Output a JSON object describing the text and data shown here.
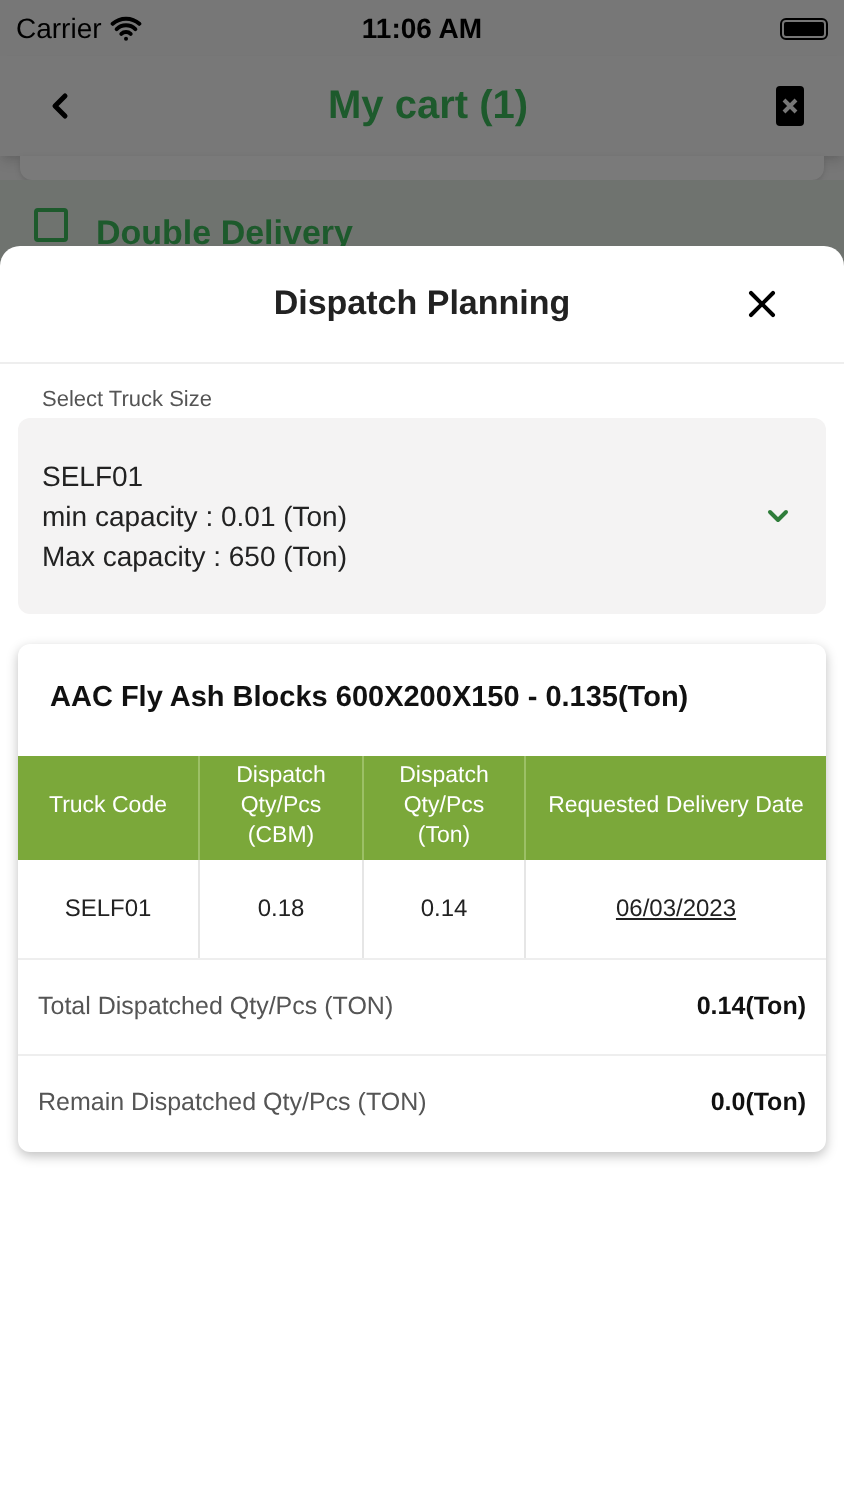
{
  "status_bar": {
    "carrier": "Carrier",
    "time": "11:06 AM"
  },
  "header": {
    "title": "My cart (1)"
  },
  "double_delivery": {
    "label": "Double Delivery",
    "checked": false
  },
  "sheet": {
    "title": "Dispatch Planning",
    "truck_select": {
      "label": "Select Truck Size",
      "lines": [
        "SELF01",
        "min capacity : 0.01 (Ton)",
        "Max capacity : 650 (Ton)"
      ]
    },
    "product": {
      "title": "AAC Fly Ash Blocks 600X200X150 - 0.135(Ton)",
      "table": {
        "columns": [
          "Truck Code",
          "Dispatch Qty/Pcs (CBM)",
          "Dispatch Qty/Pcs (Ton)",
          "Requested Delivery Date"
        ],
        "rows": [
          [
            "SELF01",
            "0.18",
            "0.14",
            "06/03/2023"
          ]
        ]
      },
      "totals": [
        {
          "label": "Total Dispatched Qty/Pcs (TON)",
          "value": "0.14(Ton)"
        },
        {
          "label": "Remain Dispatched Qty/Pcs (TON)",
          "value": "0.0(Ton)"
        }
      ]
    }
  }
}
